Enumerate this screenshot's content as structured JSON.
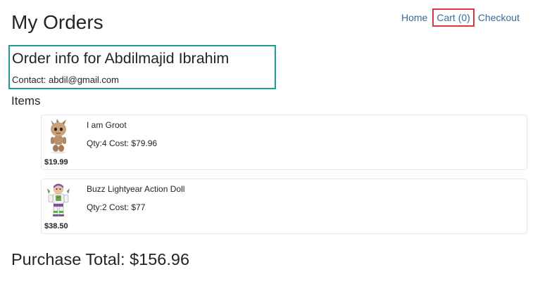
{
  "page": {
    "title": "My Orders"
  },
  "nav": {
    "home": "Home",
    "cart": "Cart (0)",
    "checkout": "Checkout"
  },
  "order": {
    "heading": "Order info for Abdilmajid Ibrahim",
    "contact": "Contact: abdil@gmail.com"
  },
  "items_heading": "Items",
  "items": [
    {
      "name": "I am Groot",
      "qty_cost": "Qty:4 Cost: $79.96",
      "price": "$19.99",
      "icon": "groot-toy-icon"
    },
    {
      "name": "Buzz Lightyear Action Doll",
      "qty_cost": "Qty:2 Cost: $77",
      "price": "$38.50",
      "icon": "buzz-lightyear-toy-icon"
    }
  ],
  "purchase_total": "Purchase Total: $156.96",
  "colors": {
    "link": "#2b6cb0",
    "cart_highlight_border": "#e0353d",
    "order_info_border": "#1aa38a",
    "card_border": "#e5e7ea"
  }
}
